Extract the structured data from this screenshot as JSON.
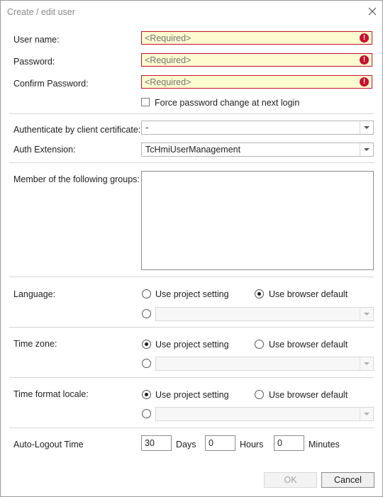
{
  "window": {
    "title": "Create / edit user"
  },
  "fields": {
    "username_label": "User name:",
    "password_label": "Password:",
    "confirm_label": "Confirm Password:",
    "required_placeholder": "<Required>",
    "error_glyph": "!",
    "force_change_label": "Force password change at next login",
    "force_change_checked": false
  },
  "auth": {
    "cert_label": "Authenticate by client certificate:",
    "cert_value": "-",
    "ext_label": "Auth Extension:",
    "ext_value": "TcHmiUserManagement"
  },
  "groups": {
    "label": "Member of the following groups:",
    "items": []
  },
  "language": {
    "label": "Language:",
    "project": "Use project setting",
    "browser": "Use browser default",
    "selected": "browser"
  },
  "timezone": {
    "label": "Time zone:",
    "project": "Use project setting",
    "browser": "Use browser default",
    "selected": "project"
  },
  "timeformat": {
    "label": "Time format locale:",
    "project": "Use project setting",
    "browser": "Use browser default",
    "selected": "project"
  },
  "autologout": {
    "label": "Auto-Logout Time",
    "days": "30",
    "days_label": "Days",
    "hours": "0",
    "hours_label": "Hours",
    "minutes": "0",
    "minutes_label": "Minutes"
  },
  "buttons": {
    "ok": "OK",
    "cancel": "Cancel",
    "ok_enabled": false
  },
  "colors": {
    "error": "#c8102e",
    "required_bg": "#fdfbd0"
  }
}
